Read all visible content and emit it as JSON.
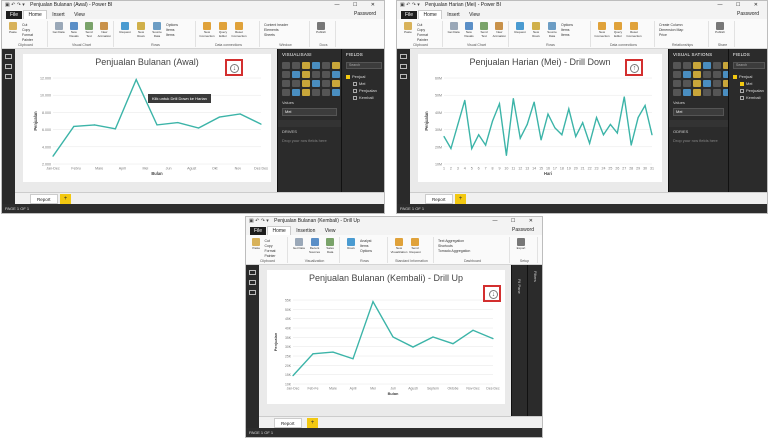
{
  "accent_color": "#3cb4a8",
  "highlight_color": "#d32f2f",
  "shots": [
    {
      "window_title": "Penjualan Bulanan (Awal) - Power BI",
      "tabs": [
        "File",
        "Home",
        "Insert",
        "View"
      ],
      "active_tab": "Home",
      "user": "Password",
      "ribbon_groups": [
        {
          "name": "Clipboard",
          "buttons": [
            "Paste"
          ],
          "small": [
            "Cut",
            "Copy",
            "Format Painter"
          ]
        },
        {
          "name": "Visual Chart",
          "buttons": [
            "Get Data",
            "New Visuals",
            "Send Text",
            "New Animation"
          ]
        },
        {
          "name": "Rows",
          "buttons": [
            "Request",
            "New Rows",
            "Source Data"
          ],
          "small": [
            "Options",
            "Items",
            "Items"
          ]
        },
        {
          "name": "Data connections",
          "buttons": [
            "New Connection",
            "Query Editor",
            "Reset Connection"
          ]
        },
        {
          "name": "Window",
          "small": [
            "Content header",
            "Elements",
            "Sheets"
          ]
        },
        {
          "name": "Docs",
          "buttons": [
            "Publish"
          ]
        }
      ],
      "chart_title": "Penjualan Bulanan (Awal)",
      "xlabel": "Bulan",
      "ylabel": "Penjualan",
      "tooltip": "Klik untuk Drill Down ke Harian",
      "visual_pane_title": "VISUALISASI",
      "fields_pane_title": "FIELDS",
      "search_placeholder": "Search",
      "fields_table": "Penjual",
      "fields": [
        "Mei",
        "Penjualan",
        "Kembali"
      ],
      "pane_rows": [
        "Values",
        "Drilled filters"
      ],
      "pane_value": "Mei",
      "pane_section": "DRIVES",
      "pane_hint": "Drop your row fields here",
      "page_tab": "Report",
      "status": "PAGE 1 OF 1"
    },
    {
      "window_title": "Penjualan Harian (Mei) - Power BI",
      "tabs": [
        "File",
        "Home",
        "Insert",
        "View"
      ],
      "active_tab": "Home",
      "user": "Password",
      "ribbon_groups": [
        {
          "name": "Clipboard",
          "buttons": [
            "Paste"
          ],
          "small": [
            "Cut",
            "Copy",
            "Format Painter"
          ]
        },
        {
          "name": "Visual Chart",
          "buttons": [
            "Get Data",
            "New Visuals",
            "Send Text",
            "New Animation"
          ]
        },
        {
          "name": "Rows",
          "buttons": [
            "Request",
            "New Rows",
            "Source Data"
          ],
          "small": [
            "Options",
            "Items",
            "Items"
          ]
        },
        {
          "name": "Data connections",
          "buttons": [
            "New Connection",
            "Query Editor",
            "Reset Connection"
          ]
        },
        {
          "name": "Relationships",
          "small": [
            "Create Column",
            "Dimension Map",
            "Price"
          ]
        },
        {
          "name": "Share",
          "buttons": [
            "Publish"
          ]
        }
      ],
      "chart_title": "Penjualan Harian (Mei) - Drill Down",
      "xlabel": "Hari",
      "ylabel": "Penjualan",
      "visual_pane_title": "VISUAL SATIONS",
      "fields_pane_title": "FIELDS",
      "search_placeholder": "Search",
      "fields_table": "Penjual",
      "fields": [
        "Mei",
        "Penjualan",
        "Kembali"
      ],
      "pane_rows": [
        "Values",
        "Drilled filters"
      ],
      "pane_value": "Mei",
      "pane_section": "ODRIES",
      "pane_hint": "Drop your row fields here",
      "page_tab": "Report",
      "status": "PAGE 1 OF 1"
    },
    {
      "window_title": "Penjualan Bulanan (Kembali) - Drill Up",
      "tabs": [
        "File",
        "Home",
        "Insertion",
        "View"
      ],
      "active_tab": "Home",
      "user": "Password",
      "ribbon_groups": [
        {
          "name": "Clipboard",
          "buttons": [
            "Paste"
          ],
          "small": [
            "Cut",
            "Copy",
            "Format Painter"
          ]
        },
        {
          "name": "Visualization",
          "buttons": [
            "Get Data",
            "Recent Sources",
            "Sales Data"
          ]
        },
        {
          "name": "Rows",
          "buttons": [
            "Rows"
          ],
          "small": [
            "Analyst",
            "Items",
            "Options"
          ]
        },
        {
          "name": "Standard Information",
          "buttons": [
            "New Visualization",
            "Send Request"
          ]
        },
        {
          "name": "Dashboard",
          "small": [
            "Text Aggregation",
            "Shortcuts",
            "Tornado Aggregation"
          ]
        },
        {
          "name": "Setup",
          "buttons": [
            "Export"
          ]
        }
      ],
      "chart_title": "Penjualan Bulanan (Kembali) - Drill Up",
      "xlabel": "Bulan",
      "ylabel": "Penjualan",
      "visual_pane_title": "Fil Pane",
      "fields_pane_title": "Filters",
      "page_tab": "Report",
      "status": "PAGE 1 OF 1"
    }
  ],
  "chart_data": [
    {
      "type": "line",
      "title": "Penjualan Bulanan (Awal)",
      "xlabel": "Bulan",
      "ylabel": "Penjualan",
      "categories": [
        "Jan-Dec",
        "Febru",
        "Mare",
        "April",
        "Mei",
        "Jun",
        "Agust",
        "Okt",
        "Nov",
        "Des Des"
      ],
      "values": [
        3000,
        6800,
        7000,
        6500,
        12800,
        7000,
        7300,
        6600,
        8000,
        8400,
        7100
      ],
      "ylim": [
        2000,
        13000
      ],
      "yticks": [
        "12.000",
        "10.000",
        "8.000",
        "6.000",
        "4.000",
        "2.000"
      ],
      "grid": true
    },
    {
      "type": "line",
      "title": "Penjualan Harian (Mei) - Drill Down",
      "xlabel": "Hari",
      "ylabel": "Penjualan",
      "categories": [
        "1",
        "2",
        "3",
        "4",
        "5",
        "6",
        "7",
        "8",
        "9",
        "10",
        "11",
        "12",
        "13",
        "14",
        "15",
        "16",
        "17",
        "18",
        "19",
        "20",
        "21",
        "22",
        "23",
        "24",
        "25",
        "26",
        "27",
        "28",
        "29",
        "30",
        "31"
      ],
      "values": [
        2600,
        1900,
        3300,
        4700,
        1900,
        2700,
        2100,
        3500,
        4500,
        1500,
        4800,
        2500,
        3300,
        4600,
        2400,
        3900,
        3100,
        2700,
        4200,
        2600,
        3400,
        2200,
        3700,
        2700,
        3300,
        2800,
        4900,
        2100,
        3700,
        4400,
        2700
      ],
      "ylim": [
        1000,
        6000
      ],
      "yticks": [
        "60M",
        "50M",
        "40M",
        "30M",
        "20M",
        "10M"
      ],
      "grid": true
    },
    {
      "type": "line",
      "title": "Penjualan Bulanan (Kembali) - Drill Up",
      "xlabel": "Bulan",
      "ylabel": "Penjualan",
      "categories": [
        "Jan-Dec",
        "Feb-Fe",
        "Mare",
        "April",
        "Mei",
        "Juli",
        "Agusti",
        "Septem",
        "Oktobe",
        "Nov-Dec",
        "Des-Dec"
      ],
      "values": [
        1000,
        2300,
        2400,
        2000,
        5400,
        3300,
        2700,
        3300,
        2900,
        3700,
        3200
      ],
      "ylim": [
        500,
        5500
      ],
      "yticks": [
        "55K",
        "50K",
        "45K",
        "40K",
        "35K",
        "30K",
        "25K",
        "20K",
        "15K",
        "10K"
      ],
      "grid": true
    }
  ]
}
